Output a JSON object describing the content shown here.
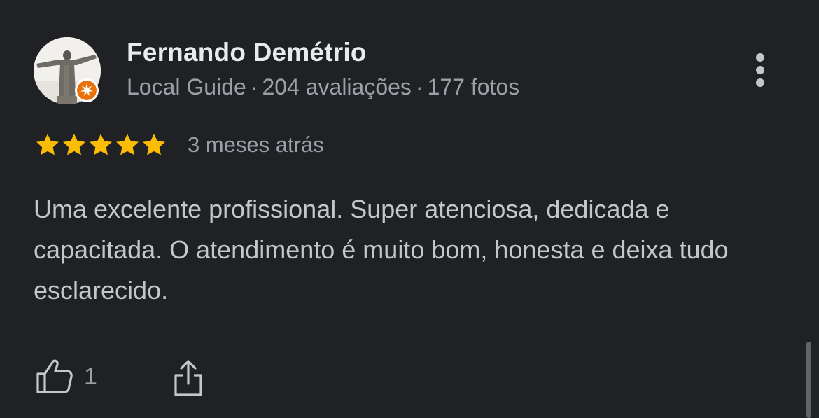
{
  "review": {
    "author": {
      "name": "Fernando Demétrio",
      "badge": "Local Guide",
      "reviews_count": "204 avaliações",
      "photos_count": "177 fotos",
      "separator": "·",
      "avatar_icon": "christ-statue-avatar",
      "badge_icon": "local-guide-badge-icon"
    },
    "rating": 5,
    "rating_max": 5,
    "date": "3 meses atrás",
    "text": "Uma excelente profissional. Super atenciosa, dedicada e capacitada. O atendimento é muito bom, honesta e deixa tudo esclarecido.",
    "likes": "1",
    "actions": {
      "more_icon": "more-vertical-icon",
      "like_icon": "thumbs-up-icon",
      "share_icon": "share-icon"
    }
  },
  "colors": {
    "background": "#202124",
    "star": "#fbbc04",
    "badge": "#e8710a",
    "name": "#e8eaed",
    "secondary": "#9aa0a6"
  }
}
